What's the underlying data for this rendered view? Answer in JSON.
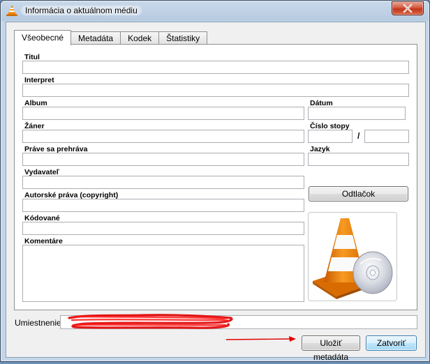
{
  "window": {
    "title": "Informácia o aktuálnom médiu",
    "accent_close": "#c1351b"
  },
  "tabs": [
    {
      "label": "Všeobecné",
      "active": true
    },
    {
      "label": "Metadáta",
      "active": false
    },
    {
      "label": "Kodek",
      "active": false
    },
    {
      "label": "Štatistiky",
      "active": false
    }
  ],
  "general": {
    "title_label": "Titul",
    "title_value": "",
    "artist_label": "Interpret",
    "artist_value": "",
    "album_label": "Album",
    "album_value": "",
    "date_label": "Dátum",
    "date_value": "",
    "genre_label": "Žáner",
    "genre_value": "",
    "track_label": "Číslo stopy",
    "track_value": "",
    "track_total": "",
    "slash": "/",
    "now_playing_label": "Práve sa prehráva",
    "now_playing_value": "",
    "language_label": "Jazyk",
    "language_value": "",
    "publisher_label": "Vydavateľ",
    "publisher_value": "",
    "copyright_label": "Autorské práva (copyright)",
    "copyright_value": "",
    "encoded_label": "Kódované",
    "encoded_value": "",
    "comments_label": "Komentáre",
    "comments_value": "",
    "print_button": "Odtlačok",
    "art_icon": "vlc-cone-disc-icon"
  },
  "footer": {
    "location_label": "Umiestnenie:",
    "location_value": "",
    "save_button": "Uložiť metadáta",
    "close_button": "Zatvoriť",
    "annotation_color": "#e00000"
  }
}
